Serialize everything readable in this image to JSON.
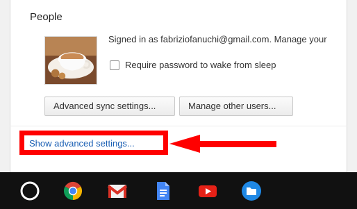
{
  "people": {
    "title": "People",
    "signed_in_prefix": "Signed in as ",
    "email": "fabriziofanuchi@gmail.com",
    "manage_suffix": ". Manage your",
    "require_password_label": "Require password to wake from sleep",
    "require_password_checked": false,
    "advanced_sync_button": "Advanced sync settings...",
    "manage_users_button": "Manage other users..."
  },
  "advanced_link": "Show advanced settings...",
  "annotation_color": "#ff0000",
  "shelf": {
    "icons": [
      "launcher-icon",
      "chrome-icon",
      "gmail-icon",
      "docs-icon",
      "youtube-icon",
      "files-icon"
    ]
  }
}
